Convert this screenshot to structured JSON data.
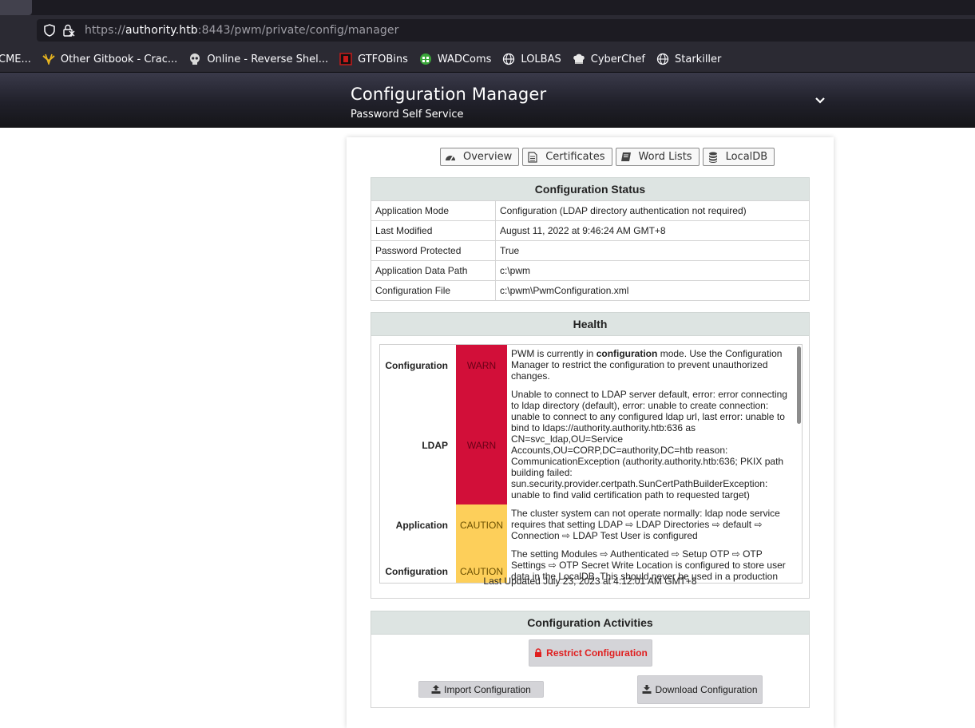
{
  "browser": {
    "url_scheme": "https://",
    "url_host": "authority.htb",
    "url_rest": ":8443/pwm/private/config/manager",
    "bookmarks": [
      {
        "label": "CME...",
        "icon": "none"
      },
      {
        "label": "Other Gitbook - Crac...",
        "icon": "gitbook-icon"
      },
      {
        "label": "Online - Reverse Shel...",
        "icon": "skull-icon"
      },
      {
        "label": "GTFOBins",
        "icon": "gtfobins-icon"
      },
      {
        "label": "WADComs",
        "icon": "wadcoms-icon"
      },
      {
        "label": "LOLBAS",
        "icon": "globe-icon"
      },
      {
        "label": "CyberChef",
        "icon": "chef-hat-icon"
      },
      {
        "label": "Starkiller",
        "icon": "globe-icon"
      }
    ]
  },
  "header": {
    "title": "Configuration Manager",
    "subtitle": "Password Self Service"
  },
  "nav": {
    "overview": "Overview",
    "certificates": "Certificates",
    "word_lists": "Word Lists",
    "localdb": "LocalDB"
  },
  "status": {
    "heading": "Configuration Status",
    "rows": [
      {
        "key": "Application Mode",
        "value": "Configuration (LDAP directory authentication not required)"
      },
      {
        "key": "Last Modified",
        "value": "August 11, 2022 at 9:46:24 AM GMT+8"
      },
      {
        "key": "Password Protected",
        "value": "True"
      },
      {
        "key": "Application Data Path",
        "value": "c:\\pwm"
      },
      {
        "key": "Configuration File",
        "value": "c:\\pwm\\PwmConfiguration.xml"
      }
    ]
  },
  "health": {
    "heading": "Health",
    "rows": [
      {
        "topic": "Configuration",
        "level": "WARN",
        "msg_before": "PWM is currently in ",
        "msg_bold": "configuration",
        "msg_after": " mode. Use the Configuration Manager to restrict the configuration to prevent unauthorized changes."
      },
      {
        "topic": "LDAP",
        "level": "WARN",
        "msg_before": "Unable to connect to LDAP server default, error: error connecting to ldap directory (default), error: unable to create connection: unable to connect to any configured ldap url, last error: unable to bind to ldaps://authority.authority.htb:636 as CN=svc_ldap,OU=Service Accounts,OU=CORP,DC=authority,DC=htb reason: CommunicationException (authority.authority.htb:636; PKIX path building failed: sun.security.provider.certpath.SunCertPathBuilderException: unable to find valid certification path to requested target)",
        "msg_bold": "",
        "msg_after": ""
      },
      {
        "topic": "Application",
        "level": "CAUTION",
        "msg_before": "The cluster system can not operate normally: ldap node service requires that setting LDAP ⇨ LDAP Directories ⇨ default ⇨ Connection ⇨ LDAP Test User is configured",
        "msg_bold": "",
        "msg_after": ""
      },
      {
        "topic": "Configuration",
        "level": "CAUTION",
        "msg_before": "The setting Modules ⇨ Authenticated ⇨ Setup OTP ⇨ OTP Settings ⇨ OTP Secret Write Location is configured to store user data in the LocalDB. This should never be used in a production environment.",
        "msg_bold": "",
        "msg_after": ""
      }
    ],
    "last_updated": "Last Updated July 23, 2023 at 4:12:01 AM GMT+8"
  },
  "activities": {
    "heading": "Configuration Activities",
    "restrict_label": "Restrict Configuration",
    "import_label": "Import Configuration",
    "download_label": "Download Configuration"
  },
  "colors": {
    "warn": "#d20f39",
    "caution": "#fdcf5a",
    "section_header": "#dde4e2",
    "restrict_text": "#e01e1e"
  }
}
